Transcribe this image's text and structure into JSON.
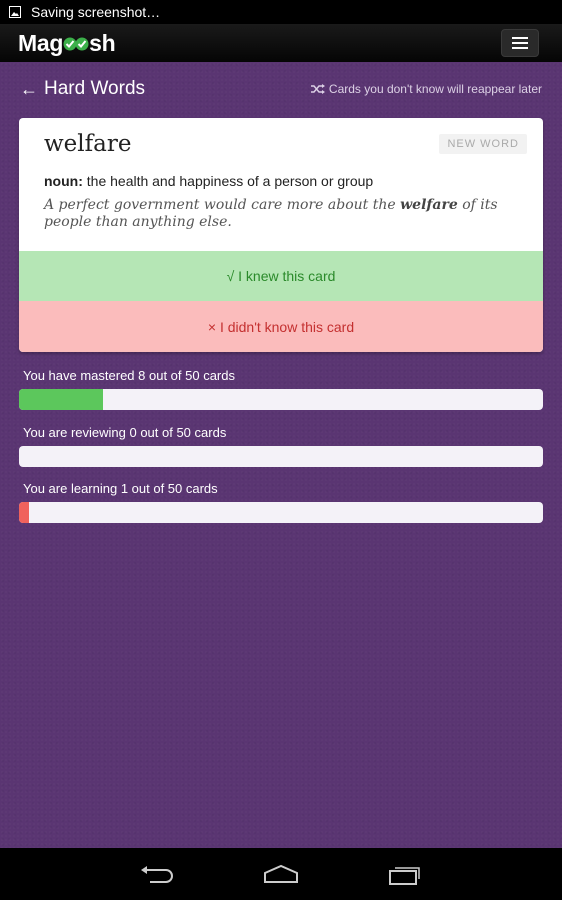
{
  "status_bar": {
    "text": "Saving screenshot…",
    "icon": "image-icon"
  },
  "header": {
    "logo_left": "Mag",
    "logo_right": "sh",
    "logo_icon": "checkmarks-icon",
    "menu_icon": "hamburger-icon"
  },
  "page": {
    "back_arrow": "←",
    "title": "Hard Words",
    "hint": "Cards you don't know will reappear later",
    "hint_icon": "shuffle-icon"
  },
  "card": {
    "word": "welfare",
    "badge": "NEW WORD",
    "part_of_speech": "noun:",
    "definition": " the health and happiness of a person or group",
    "example_before": "A perfect government would care more about the ",
    "example_word": "welfare",
    "example_after": " of its people than anything else.",
    "knew_label": "√  I knew this card",
    "didnt_label": "× I didn't know this card"
  },
  "progress": [
    {
      "label": "You have mastered 8 out of 50 cards",
      "value": 8,
      "total": 50,
      "color": "#5cc75c"
    },
    {
      "label": "You are reviewing 0 out of 50 cards",
      "value": 0,
      "total": 50,
      "color": "#f0ad4e"
    },
    {
      "label": "You are learning 1 out of 50 cards",
      "value": 1,
      "total": 50,
      "color": "#f0625c"
    }
  ],
  "nav": {
    "back_icon": "back-icon",
    "home_icon": "home-icon",
    "recents_icon": "recents-icon"
  },
  "colors": {
    "background": "#5a3572",
    "knew": "#b5e6b5",
    "didnt": "#fbbcbc"
  }
}
